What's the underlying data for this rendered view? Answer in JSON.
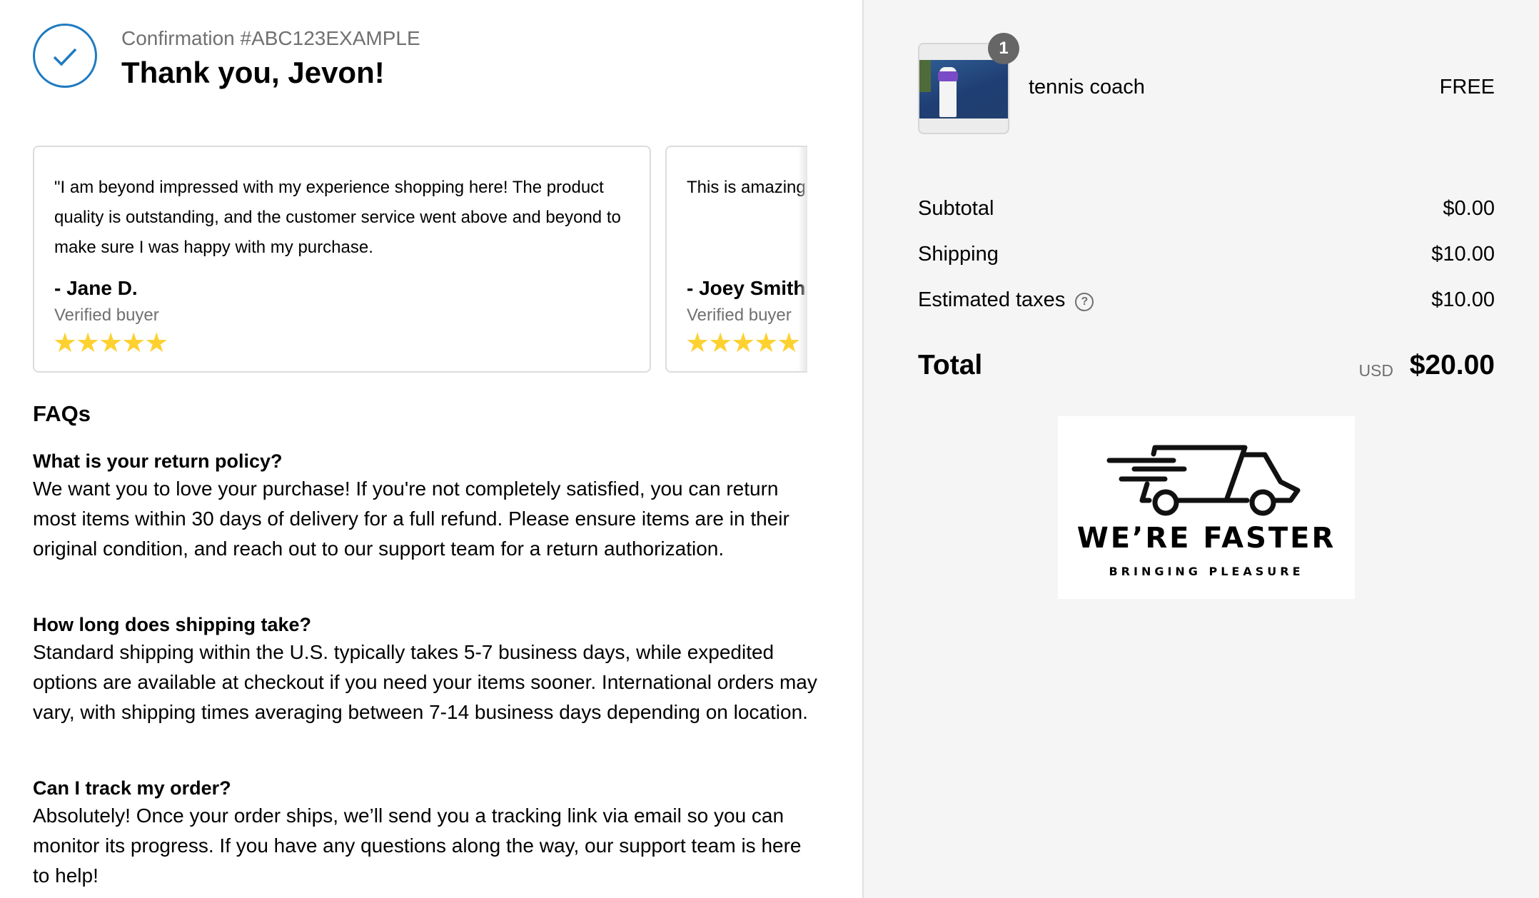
{
  "header": {
    "confirmation": "Confirmation #ABC123EXAMPLE",
    "thank_you": "Thank you, Jevon!",
    "accent_color": "#1f7bc1"
  },
  "reviews": [
    {
      "quote": "\"I am beyond impressed with my experience shopping here! The product quality is outstanding, and the customer service went above and beyond to make sure I was happy with my purchase.",
      "author": "- Jane D.",
      "verified": "Verified buyer",
      "stars": "★★★★★",
      "rating": 5
    },
    {
      "quote": "This is amazing",
      "author": "- Joey Smith",
      "verified": "Verified buyer",
      "stars": "★★★★★",
      "rating": 5
    }
  ],
  "faq": {
    "title": "FAQs",
    "items": [
      {
        "q": "What is your return policy?",
        "a": "We want you to love your purchase! If you're not completely satisfied, you can return most items within 30 days of delivery for a full refund. Please ensure items are in their original condition, and reach out to our support team for a return authorization."
      },
      {
        "q": "How long does shipping take?",
        "a": "Standard shipping within the U.S. typically takes 5-7 business days, while expedited options are available at checkout if you need your items sooner. International orders may vary, with shipping times averaging between 7-14 business days depending on location."
      },
      {
        "q": "Can I track my order?",
        "a": "Absolutely! Once your order ships, we’ll send you a tracking link via email so you can monitor its progress. If you have any questions along the way, our support team is here to help!"
      }
    ]
  },
  "order": {
    "item": {
      "name": "tennis coach",
      "price": "FREE",
      "quantity": "1"
    },
    "subtotal_label": "Subtotal",
    "subtotal": "$0.00",
    "shipping_label": "Shipping",
    "shipping": "$10.00",
    "taxes_label": "Estimated taxes",
    "taxes_help": "?",
    "taxes": "$10.00",
    "total_label": "Total",
    "currency": "USD",
    "total": "$20.00"
  },
  "logo": {
    "brand": "WE’RE FASTER",
    "tagline": "BRINGING PLEASURE"
  }
}
